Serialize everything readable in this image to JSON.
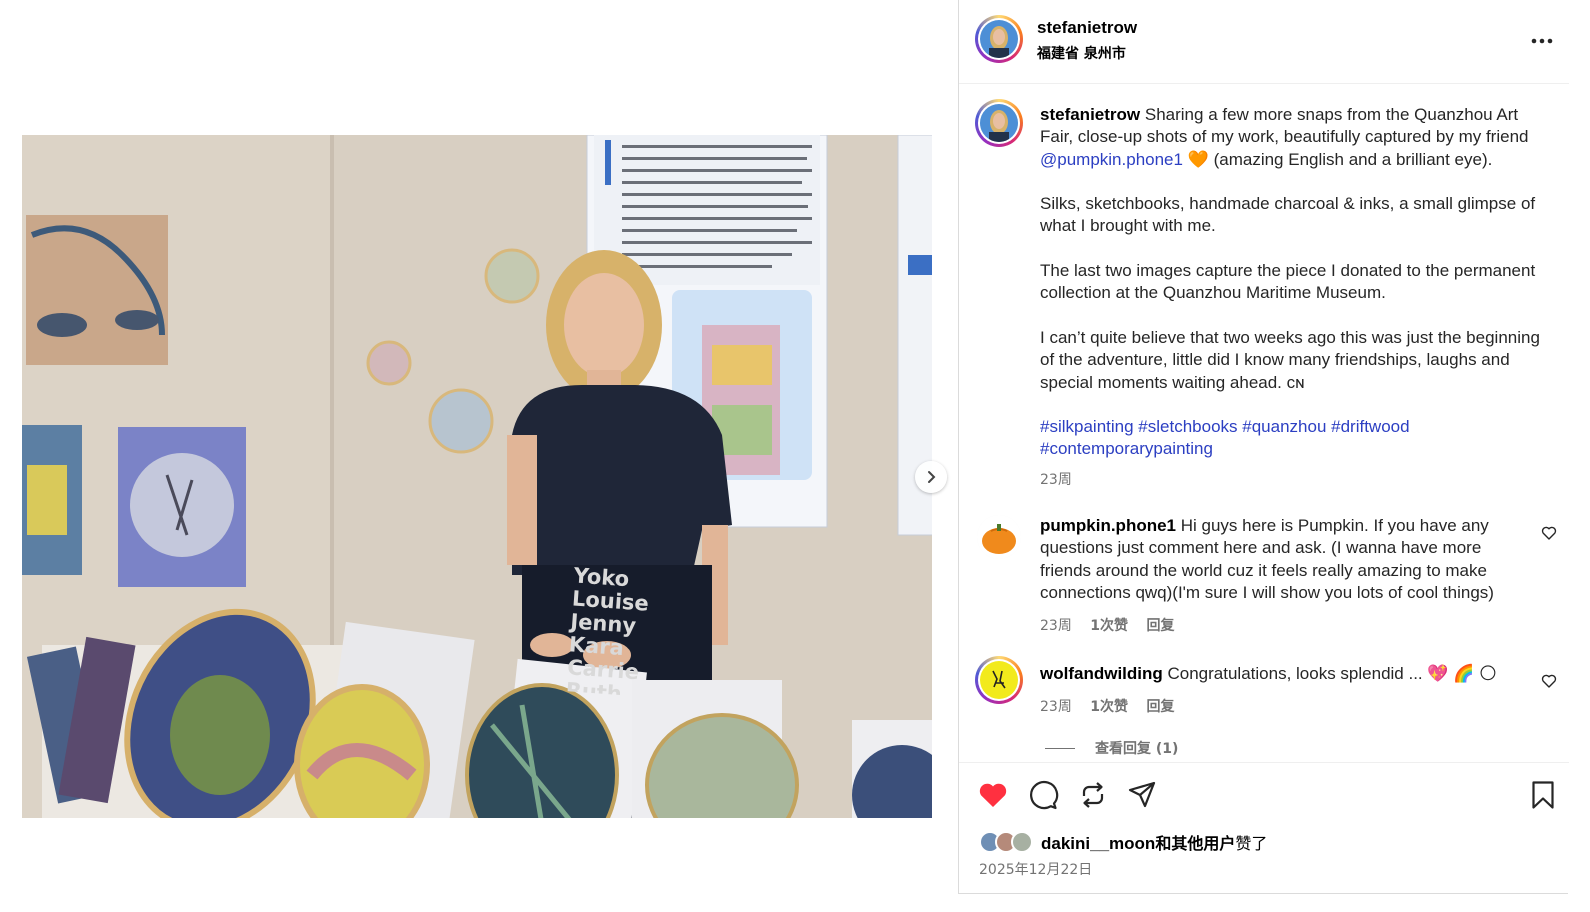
{
  "post": {
    "username": "stefanietrow",
    "location": "福建省 泉州市"
  },
  "caption": {
    "username": "stefanietrow",
    "line1_prefix": "Sharing a few more snaps from the Quanzhou Art Fair, close-up shots of my work, beautifully captured by my friend",
    "mention": "@pumpkin.phone1",
    "line1_suffix": "🧡 (amazing English and a brilliant eye).",
    "para2": "Silks, sketchbooks, handmade charcoal & inks, a small glimpse of what I brought with me.",
    "para3": "The last two images capture the piece I donated to the permanent collection at the Quanzhou Maritime Museum.",
    "para4": "I can’t quite believe that two weeks ago this was just the beginning of the adventure, little did I know many friendships, laughs and special moments waiting ahead. ᴄɴ",
    "hashtags": [
      "#silkpainting",
      "#sletchbooks",
      "#quanzhou",
      "#driftwood",
      "#contemporarypainting"
    ],
    "time": "23周"
  },
  "comments": [
    {
      "username": "pumpkin.phone1",
      "text": "Hi guys here is Pumpkin. If you have any questions just comment here and ask. (I wanna have more friends around the world cuz it feels really amazing to make connections qwq)(I'm sure I will show you lots of cool things)",
      "time": "23周",
      "likes": "1次赞",
      "reply": "回复"
    },
    {
      "username": "wolfandwilding",
      "text": "Congratulations, looks splendid ... 💖 🌈 🌕",
      "time": "23周",
      "likes": "1次赞",
      "reply": "回复",
      "view_replies": "查看回复 (1)"
    }
  ],
  "actions": {
    "liked_by_user": "dakini__moon",
    "liked_by_suffix_bold": "和其他用户",
    "liked_by_suffix": "赞了",
    "date": "2025年12月22日"
  },
  "photo": {
    "tshirt_names": [
      "Yoko",
      "Louise",
      "Jenny",
      "Kara",
      "Carrie",
      "Ruth"
    ]
  },
  "colors": {
    "like_red": "#ff3040",
    "link_blue": "#2c3fc2",
    "meta_gray": "#737373"
  },
  "icons": [
    "more-icon",
    "heart-icon",
    "comment-icon",
    "repost-icon",
    "share-icon",
    "bookmark-icon",
    "next-arrow-icon"
  ]
}
